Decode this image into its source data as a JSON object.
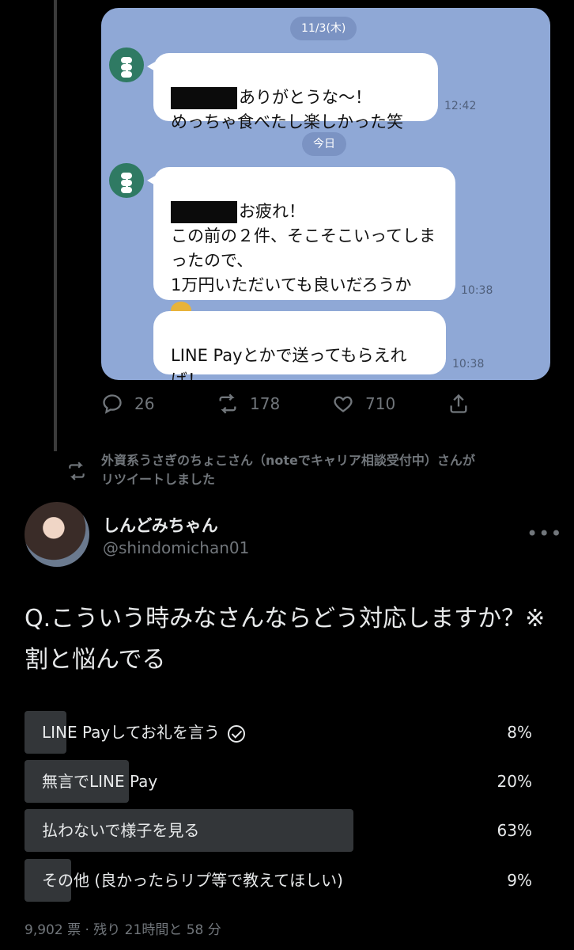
{
  "colors": {
    "background": "#000000",
    "line_chat_bg": "#8fa8d6",
    "muted_text": "#71767b",
    "poll_bar": "#333639"
  },
  "line_chat": {
    "date_chip_1": "11/3(木)",
    "messages": [
      {
        "text": "ありがとうな〜！\nめっちゃ食べたし楽しかった笑",
        "time": "12:42"
      },
      {
        "text": "お疲れ！\nこの前の２件、そこそこいってしまったので、\n1万円いただいても良いだろうか",
        "time": "10:38"
      },
      {
        "text": "LINE Payとかで送ってもらえれば！",
        "time": "10:38"
      }
    ],
    "date_chip_2": "今日",
    "avatar_icon": "dango-icon",
    "emoji_icon": "bowing-person-icon"
  },
  "first_tweet_actions": {
    "reply_count": "26",
    "retweet_count": "178",
    "like_count": "710",
    "icons": [
      "reply-icon",
      "retweet-icon",
      "heart-icon",
      "share-icon"
    ]
  },
  "retweet_info": {
    "text": "外資系うさぎのちょこさん（noteでキャリア相談受付中）さんが\nリツイートしました"
  },
  "tweet": {
    "display_name": "しんどみちゃん",
    "handle": "@shindomichan01",
    "text": "Q.こういう時みなさんならどう対応しますか？※割と悩んでる"
  },
  "poll": {
    "options": [
      {
        "label": "LINE Payしてお礼を言う",
        "percent": "8%",
        "fraction": 0.08,
        "selected": true
      },
      {
        "label": "無言でLINE Pay",
        "percent": "20%",
        "fraction": 0.2,
        "selected": false
      },
      {
        "label": "払わないで様子を見る",
        "percent": "63%",
        "fraction": 0.63,
        "selected": false
      },
      {
        "label": "その他 (良かったらリプ等で教えてほしい)",
        "percent": "9%",
        "fraction": 0.09,
        "selected": false
      }
    ],
    "footer": "9,902 票 · 残り 21時間と 58 分"
  }
}
